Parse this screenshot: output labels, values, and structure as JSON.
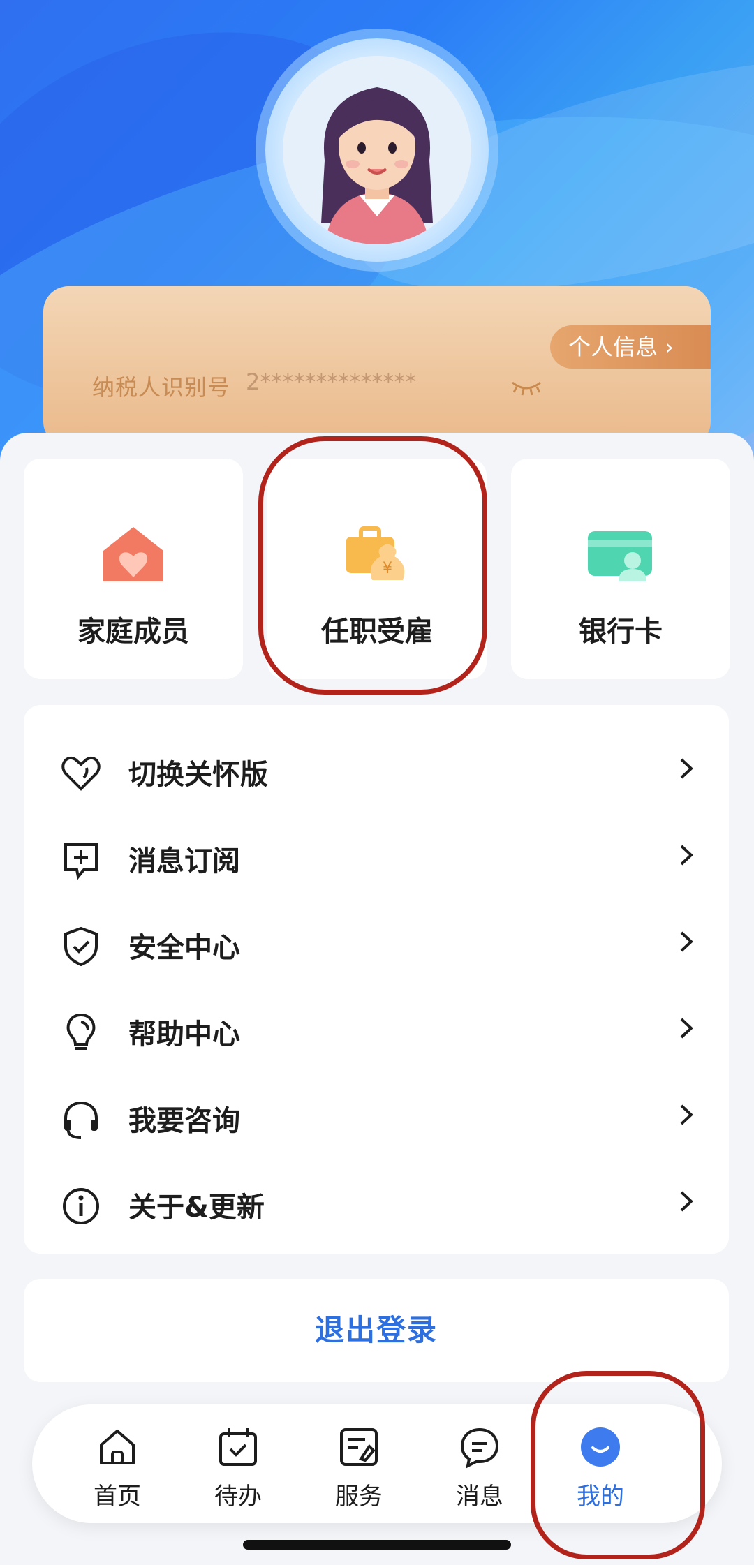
{
  "profile": {
    "tax_id_label": "纳税人识别号",
    "tax_id_masked": "2**************",
    "personal_info_button": "个人信息 ›"
  },
  "quick_actions": [
    {
      "label": "家庭成员",
      "icon": "house-heart-icon"
    },
    {
      "label": "任职受雇",
      "icon": "briefcase-money-icon"
    },
    {
      "label": "银行卡",
      "icon": "bank-card-icon"
    }
  ],
  "menu": [
    {
      "label": "切换关怀版",
      "icon": "heart-icon"
    },
    {
      "label": "消息订阅",
      "icon": "message-add-icon"
    },
    {
      "label": "安全中心",
      "icon": "shield-check-icon"
    },
    {
      "label": "帮助中心",
      "icon": "lightbulb-icon"
    },
    {
      "label": "我要咨询",
      "icon": "headset-icon"
    },
    {
      "label": "关于&更新",
      "icon": "info-icon"
    }
  ],
  "logout_label": "退出登录",
  "tabs": [
    {
      "label": "首页",
      "icon": "home-icon",
      "active": false
    },
    {
      "label": "待办",
      "icon": "calendar-check-icon",
      "active": false
    },
    {
      "label": "服务",
      "icon": "service-icon",
      "active": false
    },
    {
      "label": "消息",
      "icon": "chat-icon",
      "active": false
    },
    {
      "label": "我的",
      "icon": "smile-icon",
      "active": true
    }
  ],
  "colors": {
    "accent": "#2e6fe0",
    "highlight_ring": "#b2231b",
    "card_gold": "#eab98a"
  }
}
